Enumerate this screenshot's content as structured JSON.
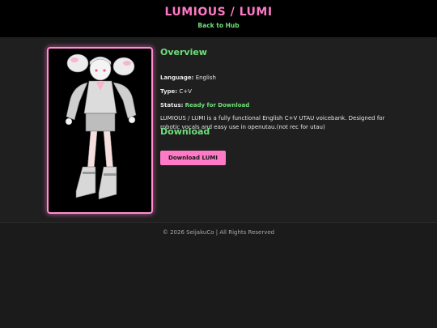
{
  "header": {
    "title": "LUMIOUS / LUMI",
    "back_link": "Back to Hub"
  },
  "colors": {
    "accent_pink": "#ff7ac6",
    "accent_green": "#6ee07a",
    "background": "#1b1b1b"
  },
  "overview": {
    "heading": "Overview",
    "language_label": "Language:",
    "language_value": "English",
    "type_label": "Type:",
    "type_value": "C+V",
    "status_label": "Status:",
    "status_value": "Ready for Download",
    "description": "LUMIOUS / LUMI is a fully functional English C+V UTAU voicebank. Designed for robotic vocals and easy use in openutau.(not rec for utau)"
  },
  "download": {
    "heading": "Download",
    "button_label": "Download LUMI"
  },
  "footer": {
    "text": "© 2026 SeijakuCo | All Rights Reserved"
  }
}
